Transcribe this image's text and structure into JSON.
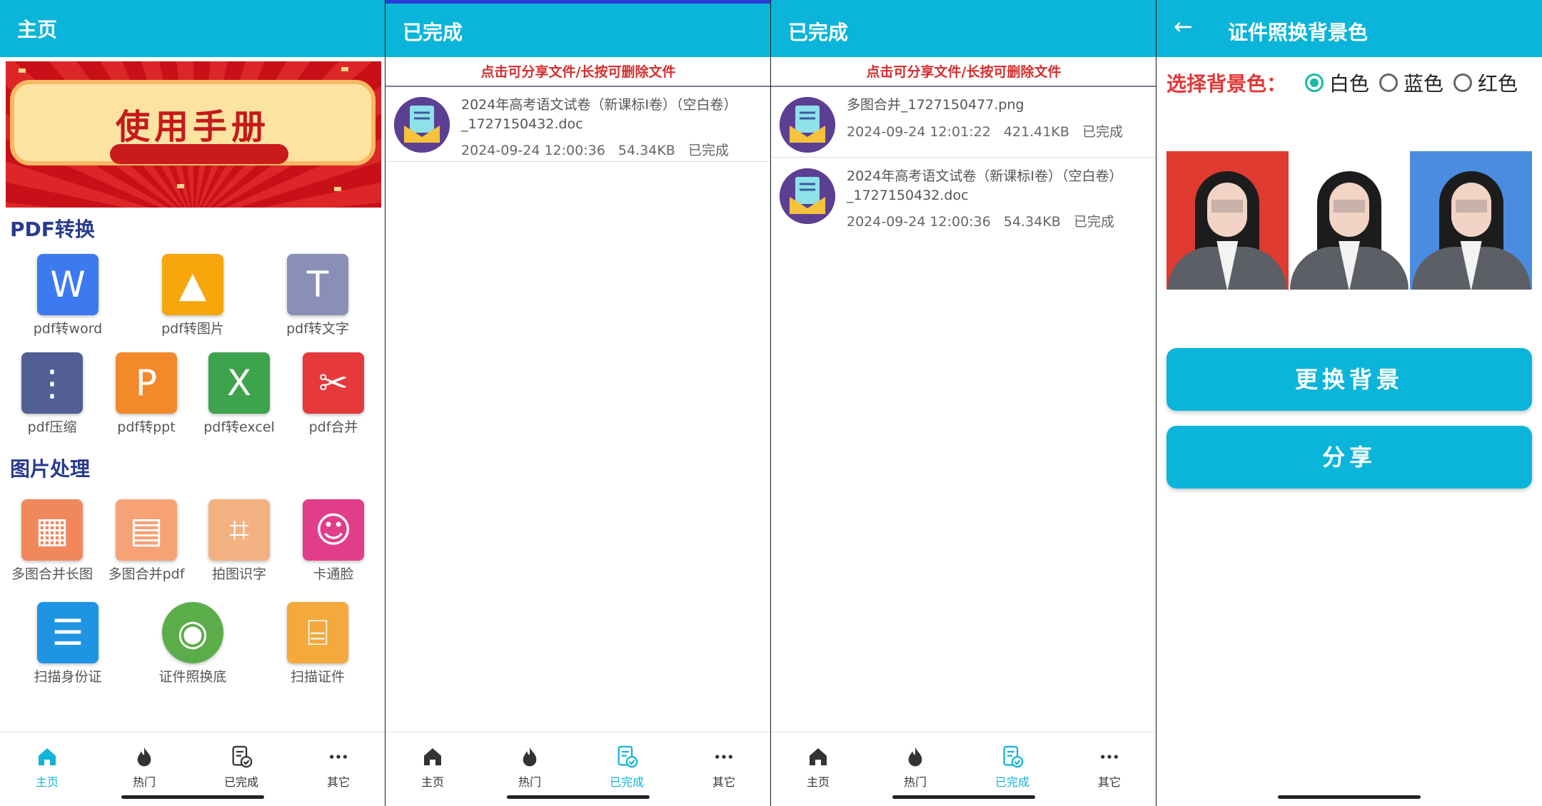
{
  "home": {
    "title": "主页",
    "banner_title": "使用手册",
    "pdf_section": "PDF转换",
    "pdf_tools": [
      {
        "label": "pdf转word",
        "glyph": "W",
        "color": "#3d7af0"
      },
      {
        "label": "pdf转图片",
        "glyph": "▲",
        "color": "#f6a60a"
      },
      {
        "label": "pdf转文字",
        "glyph": "T",
        "color": "#8a8fb6"
      },
      {
        "label": "pdf压缩",
        "glyph": "⋮",
        "color": "#525f95"
      },
      {
        "label": "pdf转ppt",
        "glyph": "P",
        "color": "#f28a2b"
      },
      {
        "label": "pdf转excel",
        "glyph": "X",
        "color": "#3da34d"
      },
      {
        "label": "pdf合并",
        "glyph": "✂",
        "color": "#e5393c"
      }
    ],
    "image_section": "图片处理",
    "image_tools": [
      {
        "label": "多图合并长图",
        "glyph": "▦",
        "color": "#f1885b"
      },
      {
        "label": "多图合并pdf",
        "glyph": "▤",
        "color": "#f6a276"
      },
      {
        "label": "拍图识字",
        "glyph": "⌗",
        "color": "#f3b080"
      },
      {
        "label": "卡通脸",
        "glyph": "☺",
        "color": "#e23d8a"
      },
      {
        "label": "扫描身份证",
        "glyph": "☰",
        "color": "#1f94e2"
      },
      {
        "label": "证件照换底",
        "glyph": "◉",
        "color": "#5aad49"
      },
      {
        "label": "扫描证件",
        "glyph": "⌸",
        "color": "#f3a93b"
      }
    ]
  },
  "nav": {
    "home": "主页",
    "hot": "热门",
    "done": "已完成",
    "other": "其它"
  },
  "done": {
    "title": "已完成",
    "hint": "点击可分享文件/长按可删除文件"
  },
  "list_a": [
    {
      "name": "2024年高考语文试卷（新课标Ⅰ卷）（空白卷）_1727150432.doc",
      "time": "2024-09-24 12:00:36",
      "size": "54.34KB",
      "status": "已完成"
    }
  ],
  "list_b": [
    {
      "name": "多图合并_1727150477.png",
      "time": "2024-09-24 12:01:22",
      "size": "421.41KB",
      "status": "已完成"
    },
    {
      "name": "2024年高考语文试卷（新课标Ⅰ卷）（空白卷）_1727150432.doc",
      "time": "2024-09-24 12:00:36",
      "size": "54.34KB",
      "status": "已完成"
    }
  ],
  "bg": {
    "title": "证件照换背景色",
    "choose_label": "选择背景色：",
    "options": [
      "白色",
      "蓝色",
      "红色"
    ],
    "selected": "白色",
    "photo_colors": [
      "#e03a31",
      "#ffffff",
      "#4a8de0"
    ],
    "change_button": "更换背景",
    "share_button": "分享"
  },
  "colors": {
    "accent": "#0ab5d9",
    "hint_red": "#d62d2d",
    "section_blue": "#2a3b8f"
  }
}
